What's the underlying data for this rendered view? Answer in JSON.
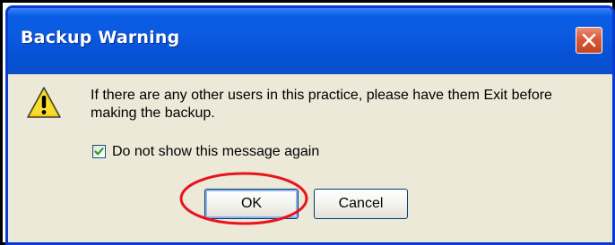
{
  "dialog": {
    "title": "Backup Warning",
    "message": "If there are any other users in this practice, please have them Exit before making the backup.",
    "checkbox": {
      "label": "Do not show this message again",
      "checked": true
    },
    "buttons": {
      "ok": "OK",
      "cancel": "Cancel"
    },
    "icons": {
      "warning": "warning-triangle-icon",
      "close": "close-x-icon",
      "check": "checkmark-icon"
    }
  },
  "colors": {
    "title_bar": "#0a5ee6",
    "dialog_face": "#ece9d8",
    "close_button": "#d65a39",
    "warning_yellow": "#f6d20c",
    "checkmark": "#21a121",
    "highlight_annotation": "#e8131b"
  }
}
